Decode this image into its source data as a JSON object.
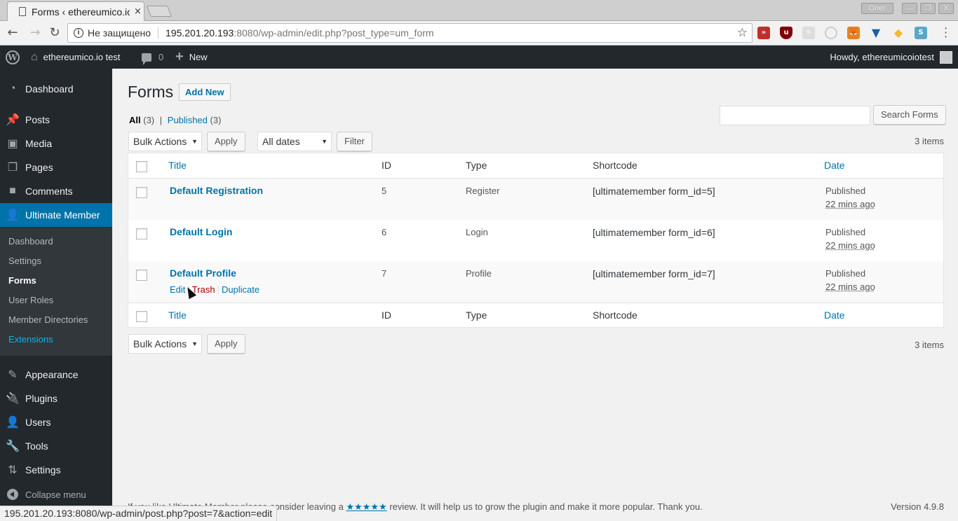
{
  "browser": {
    "tab_title": "Forms ‹ ethereumico.io test — WordPress",
    "tab_close": "×",
    "window_user": "Олег",
    "url_security_label": "Не защищено",
    "url_host": "195.201.20.193",
    "url_path": ":8080/wp-admin/edit.php?post_type=um_form",
    "status_url": "195.201.20.193:8080/wp-admin/post.php?post=7&action=edit"
  },
  "adminbar": {
    "site_name": "ethereumico.io test",
    "comments_count": "0",
    "new_label": "New",
    "howdy": "Howdy, ethereumicoiotest"
  },
  "sidebar": {
    "items": [
      {
        "label": "Dashboard",
        "icon": "dashboard-icon"
      },
      {
        "label": "Posts",
        "icon": "pin-icon"
      },
      {
        "label": "Media",
        "icon": "media-icon"
      },
      {
        "label": "Pages",
        "icon": "pages-icon"
      },
      {
        "label": "Comments",
        "icon": "comment-icon"
      },
      {
        "label": "Ultimate Member",
        "icon": "user-icon"
      },
      {
        "label": "Appearance",
        "icon": "brush-icon"
      },
      {
        "label": "Plugins",
        "icon": "plugin-icon"
      },
      {
        "label": "Users",
        "icon": "users-icon"
      },
      {
        "label": "Tools",
        "icon": "wrench-icon"
      },
      {
        "label": "Settings",
        "icon": "settings-icon"
      }
    ],
    "submenu": [
      "Dashboard",
      "Settings",
      "Forms",
      "User Roles",
      "Member Directories",
      "Extensions"
    ],
    "collapse_label": "Collapse menu"
  },
  "page": {
    "title": "Forms",
    "add_new": "Add New",
    "filters": {
      "all_label": "All",
      "all_count": "(3)",
      "published_label": "Published",
      "published_count": "(3)"
    },
    "search_placeholder": "",
    "search_button": "Search Forms",
    "bulk_actions": "Bulk Actions",
    "apply": "Apply",
    "dates": "All dates",
    "filter": "Filter",
    "items_count": "3 items"
  },
  "table": {
    "columns": {
      "title": "Title",
      "id": "ID",
      "type": "Type",
      "shortcode": "Shortcode",
      "date": "Date"
    },
    "rows": [
      {
        "title": "Default Registration",
        "id": "5",
        "type": "Register",
        "shortcode": "[ultimatemember form_id=5]",
        "status": "Published",
        "ago": "22 mins ago"
      },
      {
        "title": "Default Login",
        "id": "6",
        "type": "Login",
        "shortcode": "[ultimatemember form_id=6]",
        "status": "Published",
        "ago": "22 mins ago"
      },
      {
        "title": "Default Profile",
        "id": "7",
        "type": "Profile",
        "shortcode": "[ultimatemember form_id=7]",
        "status": "Published",
        "ago": "22 mins ago"
      }
    ],
    "row_actions": {
      "edit": "Edit",
      "trash": "Trash",
      "duplicate": "Duplicate"
    }
  },
  "footer": {
    "text_before": "If you like Ultimate Member please consider leaving a ",
    "stars": "★★★★★",
    "text_after": " review. It will help us to grow the plugin and make it more popular. Thank you.",
    "version": "Version 4.9.8"
  }
}
